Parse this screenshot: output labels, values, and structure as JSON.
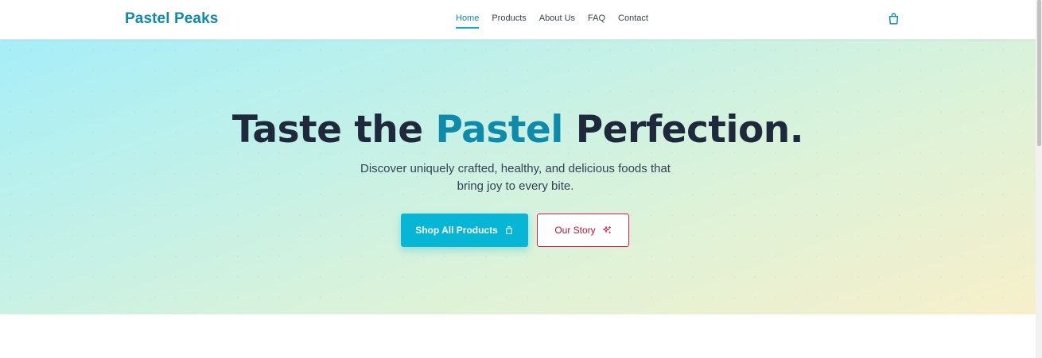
{
  "header": {
    "brand": "Pastel Peaks",
    "nav": [
      {
        "label": "Home",
        "active": true
      },
      {
        "label": "Products"
      },
      {
        "label": "About Us"
      },
      {
        "label": "FAQ"
      },
      {
        "label": "Contact"
      }
    ],
    "cart_icon": "shopping-bag-icon"
  },
  "hero": {
    "headline_before": "Taste the ",
    "headline_accent": "Pastel",
    "headline_after": " Perfection.",
    "subtext": "Discover uniquely crafted, healthy, and delicious foods that bring joy to every bite.",
    "primary_button": {
      "label": "Shop All Products",
      "icon": "shopping-bag-icon"
    },
    "secondary_button": {
      "label": "Our Story",
      "icon": "sparkles-icon"
    }
  },
  "colors": {
    "brand": "#0e8aab",
    "primary_button": "#06b6d4",
    "secondary_button_border": "#e11d48",
    "headline": "#1e293b"
  }
}
